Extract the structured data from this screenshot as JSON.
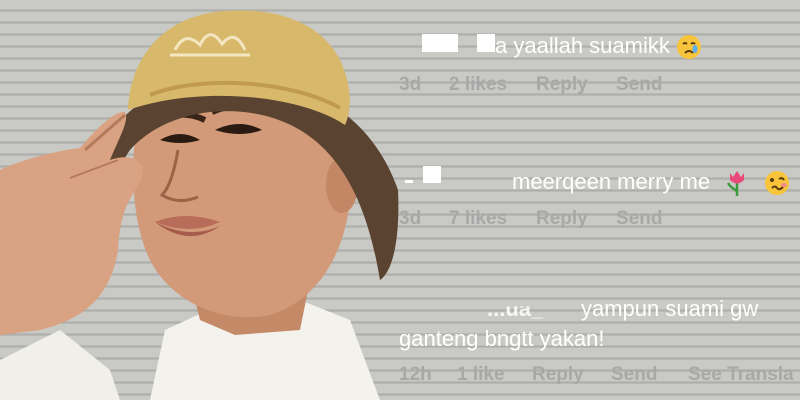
{
  "comments": [
    {
      "username": "",
      "text": "a yaallah suamikk",
      "emoji": "crying-face-icon",
      "time": "3d",
      "likes": "2 likes",
      "reply": "Reply",
      "send": "Send"
    },
    {
      "username": "",
      "text": "meerqeen merry me",
      "emoji": "tulip-icon and woozy-face-icon",
      "time": "3d",
      "likes": "7 likes",
      "reply": "Reply",
      "send": "Send"
    },
    {
      "username": "...ua_",
      "text_line1": "yampun suami gw",
      "text_line2": "ganteng bngtt yakan!",
      "time": "12h",
      "likes": "1 like",
      "reply": "Reply",
      "send": "Send",
      "translate": "See Transla"
    }
  ]
}
